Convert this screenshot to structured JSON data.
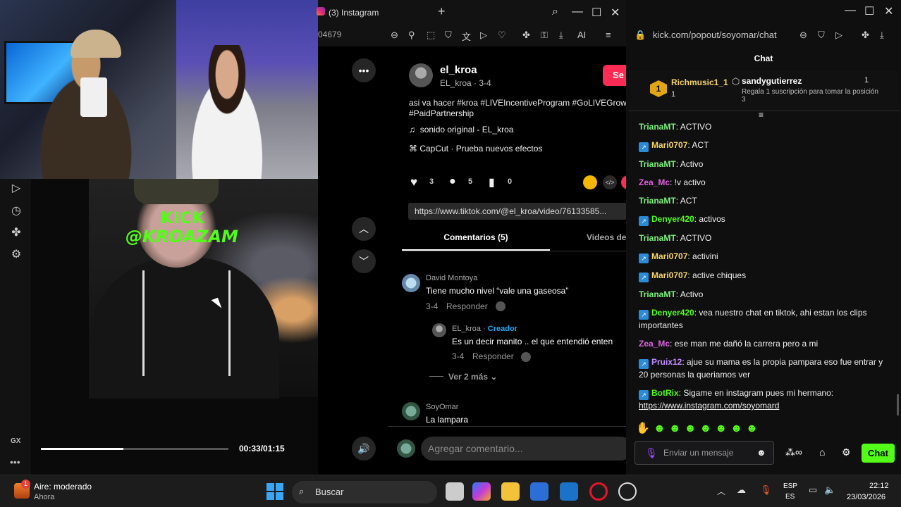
{
  "stream": {
    "overlay_line1": "KICK",
    "overlay_line2": "@KROAZAM",
    "time": "00:33/01:15",
    "progress": 0.44,
    "sidebar_gx": "GX"
  },
  "instagram_window": {
    "tab_title": "(3) Instagram",
    "url_fragment": "04679",
    "post": {
      "username": "el_kroa",
      "subline": "EL_kroa · 3-4",
      "follow_label": "Se",
      "caption": "asi va hacer #kroa #LIVEIncentiveProgram #GoLIVEGrow #PaidPartnership",
      "sound": "sonido original - EL_kroa",
      "effect": "CapCut · Prueba nuevos efectos",
      "likes": "3",
      "comments": "5",
      "saves": "0",
      "share_url": "https://www.tiktok.com/@el_kroa/video/76133585..."
    },
    "tabs": [
      "Comentarios (5)",
      "Videos de"
    ],
    "comments": [
      {
        "name": "David Montoya",
        "text": "Tiene mucho nivel “vale una gaseosa”",
        "date": "3-4",
        "reply": "Responder"
      },
      {
        "name": "EL_kroa",
        "badge": "Creador",
        "text": "Es un decir manito .. el que entendió enten",
        "date": "3-4",
        "reply": "Responder"
      },
      {
        "name": "SoyOmar",
        "text": "La lampara"
      }
    ],
    "more_replies": "Ver 2 más",
    "add_comment_placeholder": "Agregar comentario..."
  },
  "kick_window": {
    "url": "kick.com/popout/soyomar/chat",
    "chat_title": "Chat",
    "pinned": {
      "rank_user": "Richmusic1_1",
      "rank_number": "1",
      "rank_count": "1",
      "gifter": "sandygutierrez",
      "gifter_count": "1",
      "gift_text": "Regala 1 suscripción para tomar la posición 3"
    },
    "messages": [
      {
        "user": "TrianaMT",
        "color": "#7cf27c",
        "badge": false,
        "text": "ACTIVO"
      },
      {
        "user": "Mari0707",
        "color": "#f6d46b",
        "badge": true,
        "text": "ACT"
      },
      {
        "user": "TrianaMT",
        "color": "#7cf27c",
        "badge": false,
        "text": "Activo"
      },
      {
        "user": "Zea_Mc",
        "color": "#e35fe3",
        "badge": false,
        "text": "!v activo"
      },
      {
        "user": "TrianaMT",
        "color": "#7cf27c",
        "badge": false,
        "text": "ACT"
      },
      {
        "user": "Denyer420",
        "color": "#53fc18",
        "badge": true,
        "text": "activos"
      },
      {
        "user": "TrianaMT",
        "color": "#7cf27c",
        "badge": false,
        "text": "ACTIVO"
      },
      {
        "user": "Mari0707",
        "color": "#f6d46b",
        "badge": true,
        "text": "activini"
      },
      {
        "user": "Mari0707",
        "color": "#f6d46b",
        "badge": true,
        "text": "active chiques"
      },
      {
        "user": "TrianaMT",
        "color": "#7cf27c",
        "badge": false,
        "text": "Activo"
      },
      {
        "user": "Denyer420",
        "color": "#53fc18",
        "badge": true,
        "text": "vea nuestro chat en tiktok, ahi estan los clips importantes"
      },
      {
        "user": "Zea_Mc",
        "color": "#e35fe3",
        "badge": false,
        "text": "ese man me dañó la carrera pero a mi"
      },
      {
        "user": "Pruix12",
        "color": "#c38cff",
        "badge": true,
        "text": "ajue su mama es la propia pampara eso fue entrar y 20 personas la queriamos ver"
      },
      {
        "user": "BotRix",
        "color": "#53fc18",
        "badge": true,
        "text": "Sigame en instagram pues mi hermano:",
        "link": "https://www.instagram.com/soyomard"
      }
    ],
    "input_placeholder": "Enviar un mensaje",
    "chat_button": "Chat"
  },
  "taskbar": {
    "weather_title": "Aire: moderado",
    "weather_sub": "Ahora",
    "weather_badge": "1",
    "search": "Buscar",
    "lang_top": "ESP",
    "lang_bottom": "ES",
    "time": "22:12",
    "date": "23/03/2026"
  }
}
